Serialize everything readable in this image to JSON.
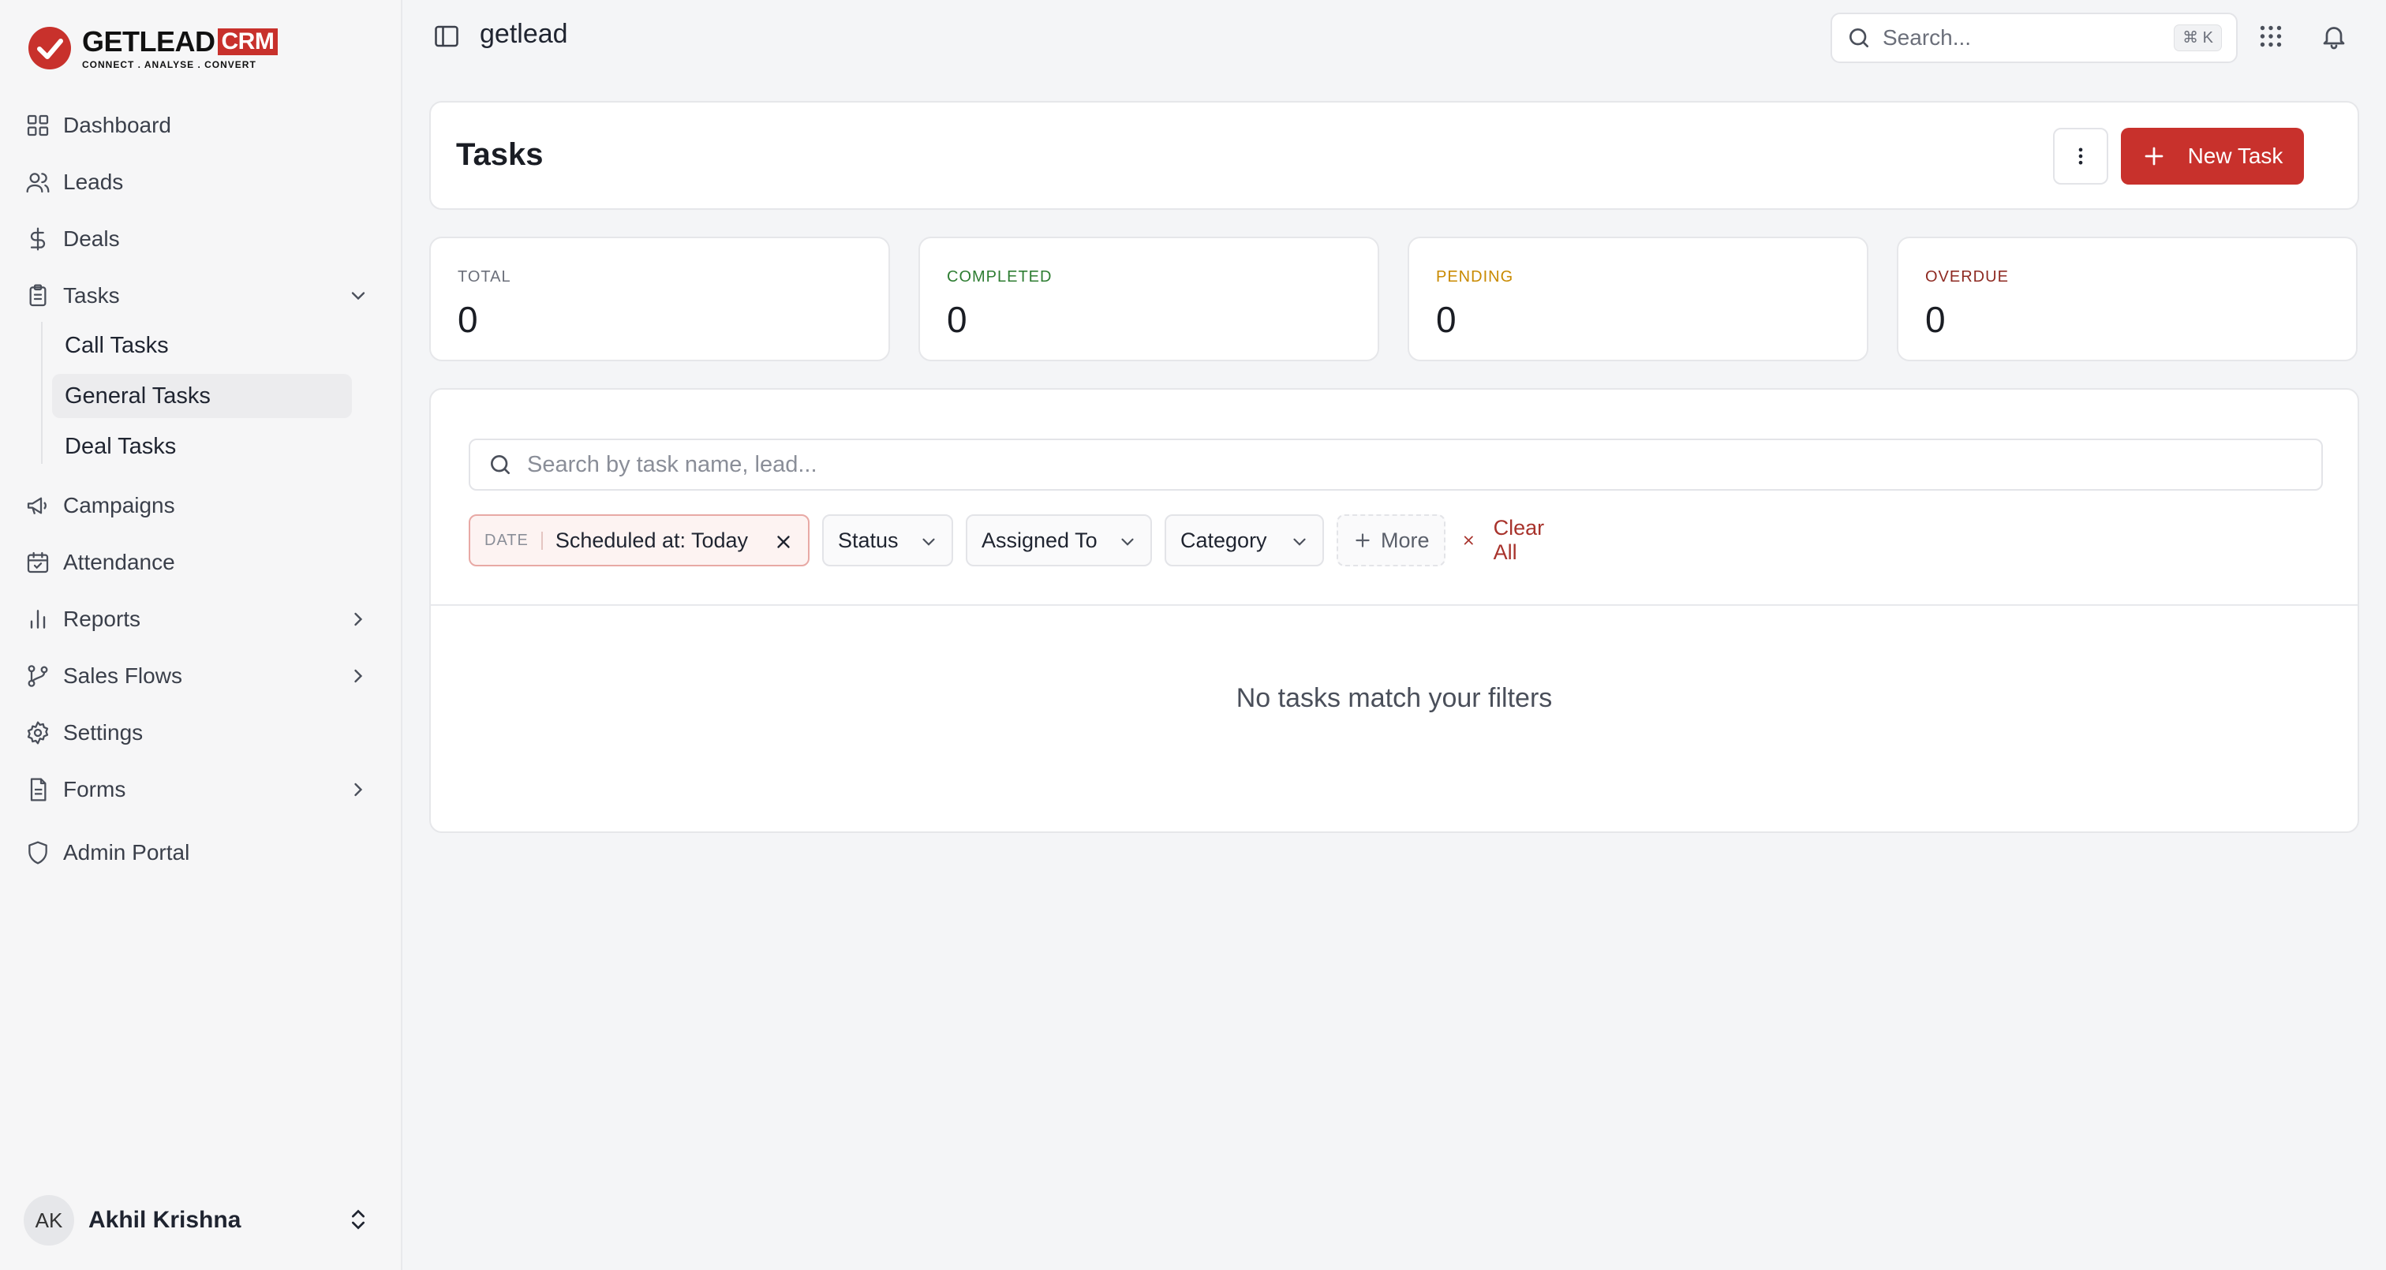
{
  "brand": {
    "word": "GETLEAD",
    "crm": "CRM",
    "tagline": "CONNECT  .  ANALYSE  .  CONVERT",
    "accent": "#c8312c"
  },
  "sidebar": {
    "items": [
      {
        "label": "Dashboard",
        "icon": "grid-icon"
      },
      {
        "label": "Leads",
        "icon": "users-icon"
      },
      {
        "label": "Deals",
        "icon": "dollar-icon"
      },
      {
        "label": "Tasks",
        "icon": "clipboard-icon",
        "expanded": true
      },
      {
        "label": "Campaigns",
        "icon": "megaphone-icon"
      },
      {
        "label": "Attendance",
        "icon": "calendar-icon"
      },
      {
        "label": "Reports",
        "icon": "bar-chart-icon"
      },
      {
        "label": "Sales Flows",
        "icon": "git-branch-icon"
      },
      {
        "label": "Settings",
        "icon": "gear-icon"
      },
      {
        "label": "Forms",
        "icon": "file-icon"
      },
      {
        "label": "Admin Portal",
        "icon": "shield-icon"
      }
    ],
    "task_subitems": [
      {
        "label": "Call Tasks"
      },
      {
        "label": "General Tasks",
        "active": true
      },
      {
        "label": "Deal Tasks"
      }
    ]
  },
  "user": {
    "initials": "AK",
    "name": "Akhil Krishna"
  },
  "topbar": {
    "workspace": "getlead",
    "search_placeholder": "Search...",
    "shortcut": "⌘ K"
  },
  "page": {
    "title": "Tasks",
    "new_task_label": "New Task"
  },
  "stats": [
    {
      "label": "TOTAL",
      "value": "0",
      "color": "#6b6f7a"
    },
    {
      "label": "COMPLETED",
      "value": "0",
      "color": "#2e7d32"
    },
    {
      "label": "PENDING",
      "value": "0",
      "color": "#c98a00"
    },
    {
      "label": "OVERDUE",
      "value": "0",
      "color": "#8e2a22"
    }
  ],
  "filters": {
    "search_placeholder": "Search by task name, lead...",
    "date_tag": "DATE",
    "date_value": "Scheduled at: Today",
    "status": "Status",
    "assigned_to": "Assigned To",
    "category": "Category",
    "more": "More",
    "clear_all": "Clear All"
  },
  "empty_message": "No tasks match your filters"
}
